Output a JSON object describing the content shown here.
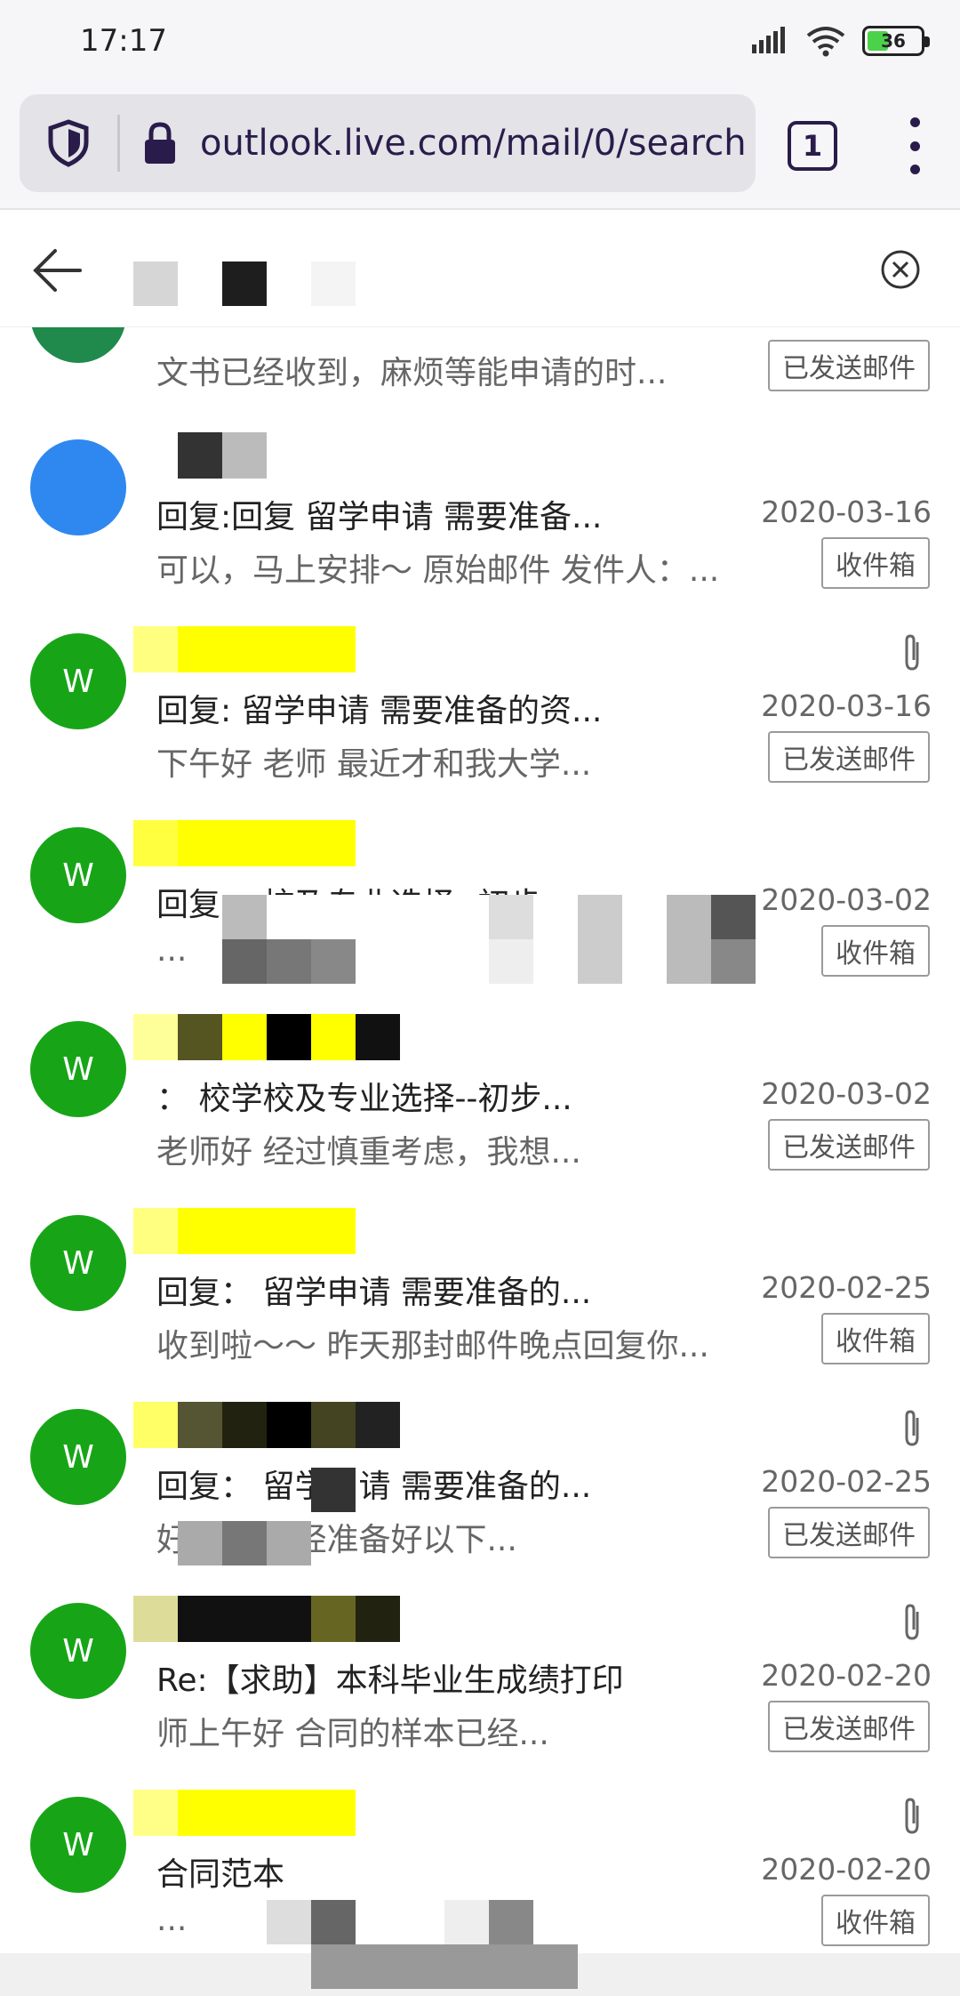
{
  "status_bar": {
    "time": "17:17",
    "battery": 36,
    "icons": [
      "signal-icon",
      "wifi-icon",
      "battery-icon"
    ]
  },
  "browser": {
    "url": "outlook.live.com/mail/0/search",
    "tab_count": "1",
    "icons": [
      "shield-icon",
      "lock-icon",
      "menu-dots-icon"
    ]
  },
  "search_header": {
    "icons": [
      "back-arrow-icon",
      "clear-search-icon"
    ]
  },
  "mail_top": {
    "preview": "文书已经收到，麻烦等能申请的时...",
    "folder": "已发送邮件"
  },
  "mails": [
    {
      "avatar": "",
      "avatar_color": "#2e88f0",
      "subject": "回复:回复         留学申请 需要准备...",
      "date": "2020-03-16",
      "preview": "可以，马上安排～ 原始邮件 发件人：...",
      "folder": "收件箱",
      "attachment": false
    },
    {
      "avatar": "W",
      "avatar_color": "#17a517",
      "subject": "回复:        留学申请 需要准备的资...",
      "date": "2020-03-16",
      "preview": "下午好        老师 最近才和我大学...",
      "folder": "已发送邮件",
      "attachment": true
    },
    {
      "avatar": "W",
      "avatar_color": "#17a517",
      "subject": "回复：                 校及专业选择--初步",
      "date": "2020-03-02",
      "preview": "                                             ...",
      "folder": "收件箱",
      "attachment": false
    },
    {
      "avatar": "W",
      "avatar_color": "#17a517",
      "subject": "       ：         校学校及专业选择--初步...",
      "date": "2020-03-02",
      "preview": "      老师好 经过慎重考虑，我想...",
      "folder": "已发送邮件",
      "attachment": false
    },
    {
      "avatar": "W",
      "avatar_color": "#17a517",
      "subject": "回复：           留学申请 需要准备的...",
      "date": "2020-02-25",
      "preview": "收到啦～～ 昨天那封邮件晚点回复你...",
      "folder": "收件箱",
      "attachment": false
    },
    {
      "avatar": "W",
      "avatar_color": "#17a517",
      "subject": "回复：           留学申请 需要准备的...",
      "date": "2020-02-25",
      "preview": "                 好 目前已经准备好以下...",
      "folder": "已发送邮件",
      "attachment": true
    },
    {
      "avatar": "W",
      "avatar_color": "#17a517",
      "subject": "Re:【求助】本科毕业生成绩打印",
      "date": "2020-02-20",
      "preview": "      师上午好 合同的样本已经...",
      "folder": "已发送邮件",
      "attachment": true
    },
    {
      "avatar": "W",
      "avatar_color": "#17a517",
      "subject": "合同范本",
      "date": "2020-02-20",
      "preview": "                                           ...",
      "folder": "收件箱",
      "attachment": true
    }
  ]
}
